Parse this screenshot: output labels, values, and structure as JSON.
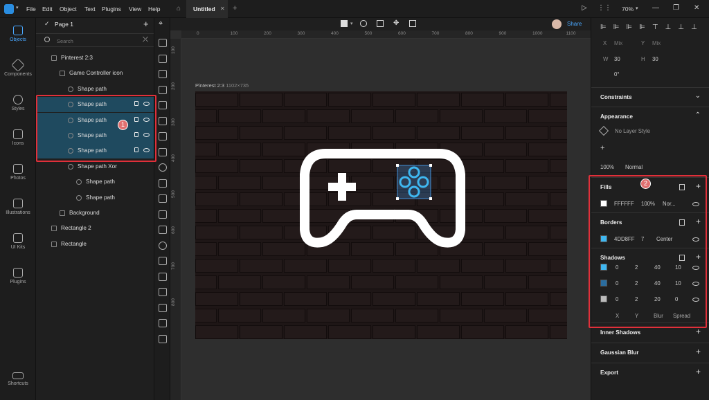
{
  "menubar": {
    "items": [
      "File",
      "Edit",
      "Object",
      "Text",
      "Plugins",
      "View",
      "Help"
    ],
    "tab_title": "Untitled",
    "zoom": "70%"
  },
  "rail": [
    "Objects",
    "Components",
    "Styles",
    "Icons",
    "Photos",
    "Illustrations",
    "UI Kits",
    "Plugins",
    "Shortcuts"
  ],
  "layers": {
    "page": "Page 1",
    "search_placeholder": "Search",
    "rows": [
      {
        "label": "Pinterest 2:3",
        "indent": 0
      },
      {
        "label": "Game Controller icon",
        "indent": 1
      },
      {
        "label": "Shape path",
        "indent": 2
      },
      {
        "label": "Shape path",
        "indent": 2,
        "selected": true
      },
      {
        "label": "Shape path",
        "indent": 2,
        "selected": true
      },
      {
        "label": "Shape path",
        "indent": 2,
        "selected": true
      },
      {
        "label": "Shape path",
        "indent": 2,
        "selected": true
      },
      {
        "label": "Shape path Xor",
        "indent": 2
      },
      {
        "label": "Shape path",
        "indent": 3
      },
      {
        "label": "Shape path",
        "indent": 3
      },
      {
        "label": "Background",
        "indent": 1
      },
      {
        "label": "Rectangle 2",
        "indent": 0
      },
      {
        "label": "Rectangle",
        "indent": 0
      }
    ]
  },
  "topbar": {
    "share": "Share"
  },
  "ruler_h": [
    "0",
    "100",
    "200",
    "300",
    "400",
    "500",
    "600",
    "700",
    "800",
    "900",
    "1000",
    "1100"
  ],
  "ruler_v": [
    "100",
    "200",
    "300",
    "400",
    "500",
    "600",
    "700",
    "800"
  ],
  "artboard": {
    "name": "Pinterest 2:3",
    "size": "1102×735"
  },
  "inspector": {
    "x_label": "X",
    "x_value": "Mix",
    "y_label": "Y",
    "y_value": "Mix",
    "w_label": "W",
    "w_value": "30",
    "h_label": "H",
    "h_value": "30",
    "rotation": "0°",
    "constraints": "Constraints",
    "appearance": "Appearance",
    "layer_style": "No Layer Style",
    "opacity": "100%",
    "blend": "Normal",
    "fills": {
      "title": "Fills",
      "hex": "FFFFFF",
      "opacity": "100%",
      "blend": "Nor...",
      "color": "#ffffff"
    },
    "borders": {
      "title": "Borders",
      "hex": "4DD8FF",
      "width": "7",
      "position": "Center",
      "color": "#3fb7f0"
    },
    "shadows": {
      "title": "Shadows",
      "rows": [
        {
          "x": "0",
          "y": "2",
          "blur": "40",
          "spread": "10"
        },
        {
          "x": "0",
          "y": "2",
          "blur": "40",
          "spread": "10"
        },
        {
          "x": "0",
          "y": "2",
          "blur": "20",
          "spread": "0"
        }
      ],
      "labels": {
        "x": "X",
        "y": "Y",
        "blur": "Blur",
        "spread": "Spread"
      }
    },
    "inner_shadows": "Inner Shadows",
    "gaussian_blur": "Gaussian Blur",
    "export": "Export"
  },
  "annotations": {
    "one": "1",
    "two": "2"
  },
  "colors": {
    "accent": "#4aa8ff",
    "highlight_red": "#e0303a",
    "selection": "#1f4a5f"
  }
}
